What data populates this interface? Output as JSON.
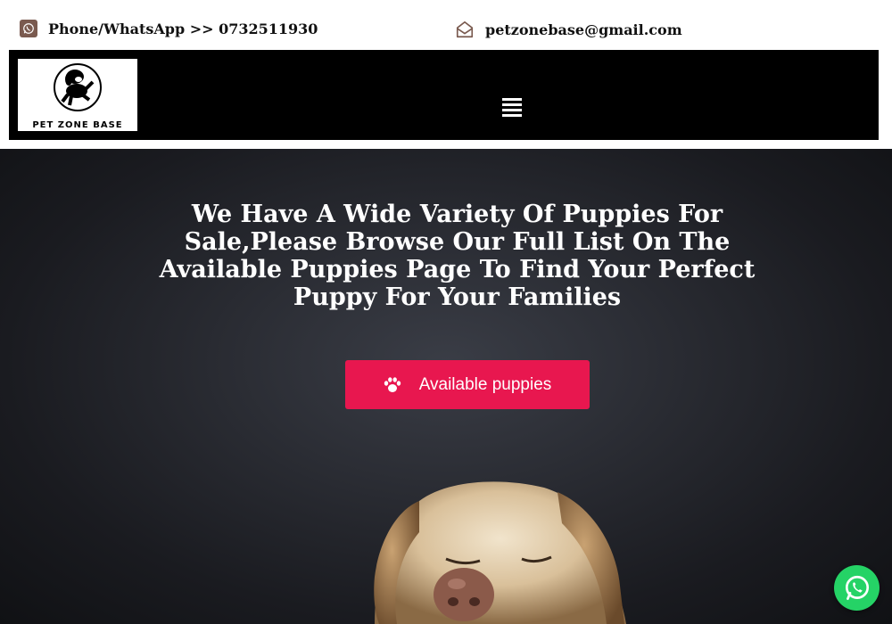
{
  "topbar": {
    "phone_text": "Phone/WhatsApp >> 0732511930",
    "email_text": "petzonebase@gmail.com"
  },
  "logo": {
    "text": "PET ZONE BASE"
  },
  "hero": {
    "title": "We Have A Wide Variety Of Puppies For Sale,Please Browse Our Full List On The Available Puppies Page To Find Your Perfect Puppy For Your Families",
    "cta_label": "Available puppies"
  },
  "colors": {
    "cta": "#e8174f",
    "nav_bg": "#000000",
    "whatsapp": "#25d366",
    "phone_icon_bg": "#7a5a4f"
  },
  "icons": [
    "whatsapp-icon",
    "envelope-icon",
    "hamburger-menu-icon",
    "paw-icon",
    "whatsapp-float-icon"
  ]
}
